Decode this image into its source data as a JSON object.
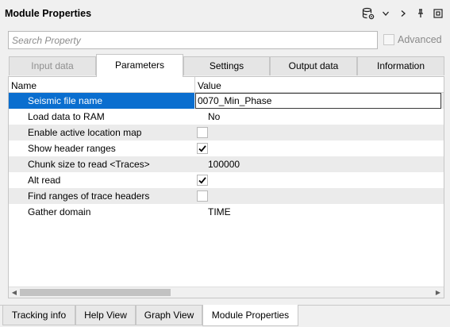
{
  "panel": {
    "title": "Module Properties",
    "icons": [
      "database-settings-icon",
      "chevron-down-icon",
      "chevron-right-icon",
      "pin-icon",
      "popout-icon"
    ]
  },
  "search": {
    "placeholder": "Search Property",
    "value": "",
    "advanced_label": "Advanced",
    "advanced_checked": false
  },
  "tabs": [
    {
      "label": "Input data",
      "state": "disabled"
    },
    {
      "label": "Parameters",
      "state": "active"
    },
    {
      "label": "Settings",
      "state": "normal"
    },
    {
      "label": "Output data",
      "state": "normal"
    },
    {
      "label": "Information",
      "state": "normal"
    }
  ],
  "grid": {
    "columns": [
      "Name",
      "Value"
    ],
    "rows": [
      {
        "name": "Seismic file name",
        "type": "text",
        "value": "0070_Min_Phase",
        "selected": true
      },
      {
        "name": "Load data to RAM",
        "type": "text",
        "value": "No"
      },
      {
        "name": "Enable active location map",
        "type": "checkbox",
        "checked": false
      },
      {
        "name": "Show header ranges",
        "type": "checkbox",
        "checked": true
      },
      {
        "name": "Chunk size to read <Traces>",
        "type": "text",
        "value": "100000"
      },
      {
        "name": "Alt read",
        "type": "checkbox",
        "checked": true
      },
      {
        "name": "Find ranges of trace headers",
        "type": "checkbox",
        "checked": false
      },
      {
        "name": "Gather domain",
        "type": "text",
        "value": "TIME"
      }
    ]
  },
  "bottom_tabs": [
    {
      "label": "Tracking info",
      "active": false
    },
    {
      "label": "Help View",
      "active": false
    },
    {
      "label": "Graph View",
      "active": false
    },
    {
      "label": "Module Properties",
      "active": true
    }
  ],
  "colors": {
    "selection": "#0a6ecf",
    "alt_row": "#ebebeb",
    "panel_bg": "#f0f0f0"
  }
}
